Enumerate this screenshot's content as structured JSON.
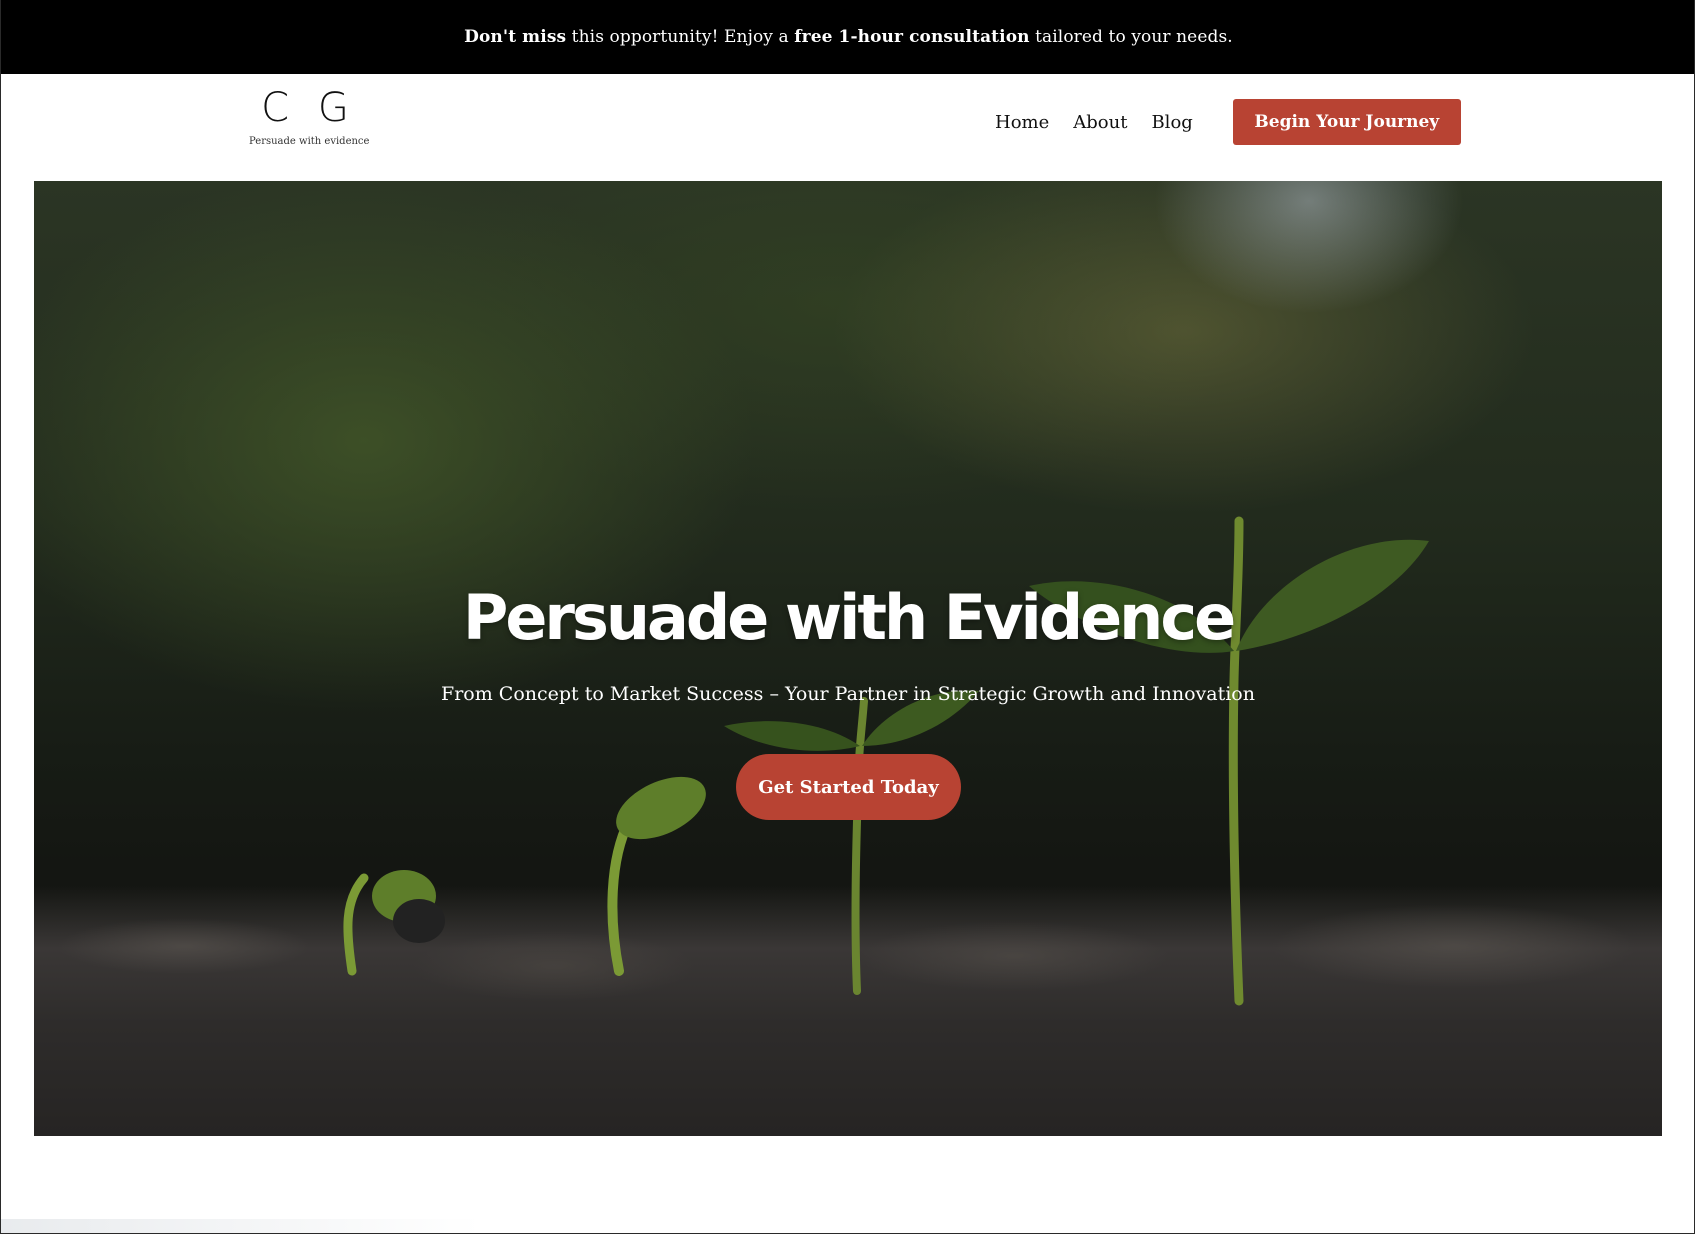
{
  "announcement": {
    "bold_1": "Don't miss",
    "text_1": " this opportunity! Enjoy a ",
    "bold_2": "free 1-hour consultation",
    "text_2": " tailored to your needs."
  },
  "header": {
    "logo_mark": "C G",
    "logo_tagline": "Persuade with evidence",
    "nav": {
      "home": "Home",
      "about": "About",
      "blog": "Blog"
    },
    "cta_label": "Begin Your Journey"
  },
  "hero": {
    "title": "Persuade with Evidence",
    "subtitle": "From Concept to Market Success – Your Partner in Strategic Growth and Innovation",
    "cta_label": "Get Started Today"
  },
  "colors": {
    "accent": "#b84333",
    "announcement_bg": "#000000",
    "text_dark": "#111111"
  }
}
